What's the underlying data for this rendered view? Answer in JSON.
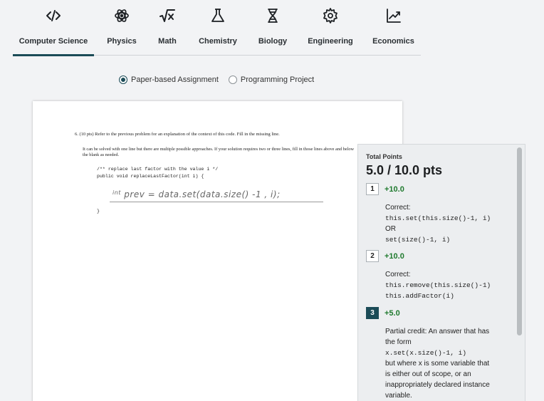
{
  "tabs": [
    {
      "label": "Computer Science",
      "icon": "code-icon",
      "active": true
    },
    {
      "label": "Physics",
      "icon": "atom-icon"
    },
    {
      "label": "Math",
      "icon": "square-root-icon"
    },
    {
      "label": "Chemistry",
      "icon": "flask-icon"
    },
    {
      "label": "Biology",
      "icon": "dna-icon"
    },
    {
      "label": "Engineering",
      "icon": "gear-icon"
    },
    {
      "label": "Economics",
      "icon": "chart-trend-icon"
    }
  ],
  "mode": {
    "options": [
      "Paper-based Assignment",
      "Programming Project"
    ],
    "selected": "Paper-based Assignment"
  },
  "paper": {
    "question": "6. (10 pts) Refer to the previous problem for an explanation of the context of this code. Fill in the missing line.",
    "instructions": "It can be solved with one line but there are multiple possible approaches. If your solution requires two or three lines, fill in those lines above and below the blank as needed.",
    "code_lines": [
      "/** replace last factor with the value i */",
      "public void replaceLastFactor(int i) {",
      "}"
    ],
    "handwritten_prefix": "int",
    "handwritten_answer": "prev = data.set(data.size() -1 , i);"
  },
  "score": {
    "label": "Total Points",
    "value": "5.0 / 10.0 pts",
    "items": [
      {
        "num": "1",
        "points": "+10.0",
        "lines": [
          "Correct:",
          "this.set(this.size()-1, i)",
          "OR",
          "set(size()-1, i)"
        ],
        "mono": [
          false,
          true,
          false,
          true
        ]
      },
      {
        "num": "2",
        "points": "+10.0",
        "lines": [
          "Correct:",
          "this.remove(this.size()-1)",
          "this.addFactor(i)"
        ],
        "mono": [
          false,
          true,
          true
        ]
      },
      {
        "num": "3",
        "points": "+5.0",
        "selected": true,
        "lines": [
          "Partial credit:  An answer that has",
          "the form",
          "x.set(x.size()-1, i)",
          "but where x is some variable that",
          "is either out of scope, or an",
          "inappropriately declared instance",
          "variable."
        ],
        "mono": [
          false,
          false,
          true,
          false,
          false,
          false,
          false
        ]
      }
    ]
  }
}
